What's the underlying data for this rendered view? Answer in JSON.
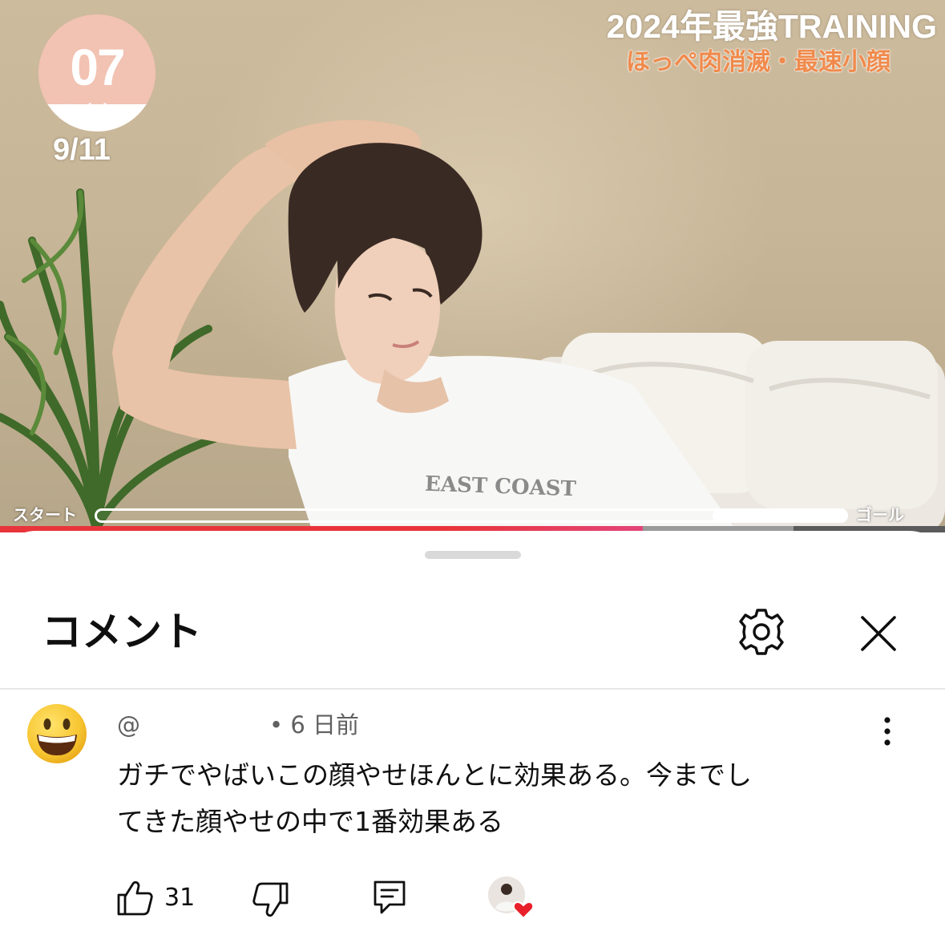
{
  "video": {
    "badge_number": "07",
    "badge_word": "training",
    "progress_count": "9/11",
    "title_main": "2024年最強TRAINING",
    "title_sub": "ほっぺ肉消滅・最速小顔",
    "shirt_print": "EAST COAST",
    "race_start_label": "スタート",
    "race_goal_label": "ゴール",
    "race_progress_fraction": 0.82,
    "seek_played_fraction": 0.68,
    "seek_buffered_fraction": 0.84,
    "colors": {
      "badge": "#f2c2b2",
      "subtitle": "#f08a4c",
      "seek_played": "#e8353b"
    }
  },
  "sheet": {
    "title": "コメント",
    "settings_icon": "gear-icon",
    "close_icon": "close-icon"
  },
  "comment": {
    "author_prefix": "@",
    "timestamp": "• 6 日前",
    "text_line1": "ガチでやばいこの顔やせほんとに効果ある。今までし",
    "text_line2": "てきた顔やせの中で1番効果ある",
    "like_count": "31",
    "avatar_icon": "grinning-face-emoji",
    "more_icon": "more-vertical-icon",
    "like_icon": "thumbs-up-icon",
    "dislike_icon": "thumbs-down-icon",
    "reply_icon": "reply-icon",
    "creator_heart_icon": "creator-heart-icon"
  }
}
